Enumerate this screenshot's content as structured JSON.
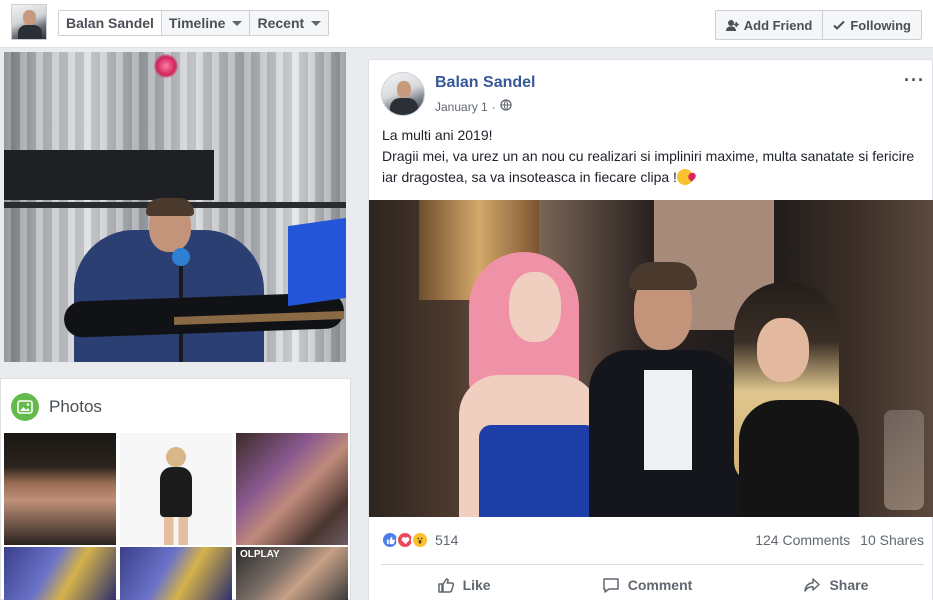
{
  "header": {
    "tabs": [
      {
        "label": "Balan Sandel"
      },
      {
        "label": "Timeline"
      },
      {
        "label": "Recent"
      }
    ],
    "buttons": {
      "add_friend": "Add Friend",
      "following": "Following"
    }
  },
  "sidebar": {
    "photos_title": "Photos",
    "thumb_logo_text": "OLPLAY"
  },
  "post": {
    "author": "Balan Sandel",
    "date": "January 1",
    "more": "···",
    "text_line1": "La multi ani 2019!",
    "text_line2": "Dragii mei, va urez un an nou cu realizari si impliniri maxime, multa sanatate si fericire iar dragostea, sa va insoteasca in fiecare clipa !",
    "reaction_count": "514",
    "comments": "124 Comments",
    "shares": "10 Shares",
    "actions": {
      "like": "Like",
      "comment": "Comment",
      "share": "Share"
    }
  },
  "icons": {
    "like": "like-icon",
    "love": "love-icon",
    "wow": "wow-icon",
    "globe": "globe-icon",
    "photos": "photos-icon"
  },
  "colors": {
    "link": "#365899",
    "like": "#4d7ee9",
    "love": "#ed4a5f",
    "wow": "#f7c22d",
    "photos": "#64bb4c"
  }
}
